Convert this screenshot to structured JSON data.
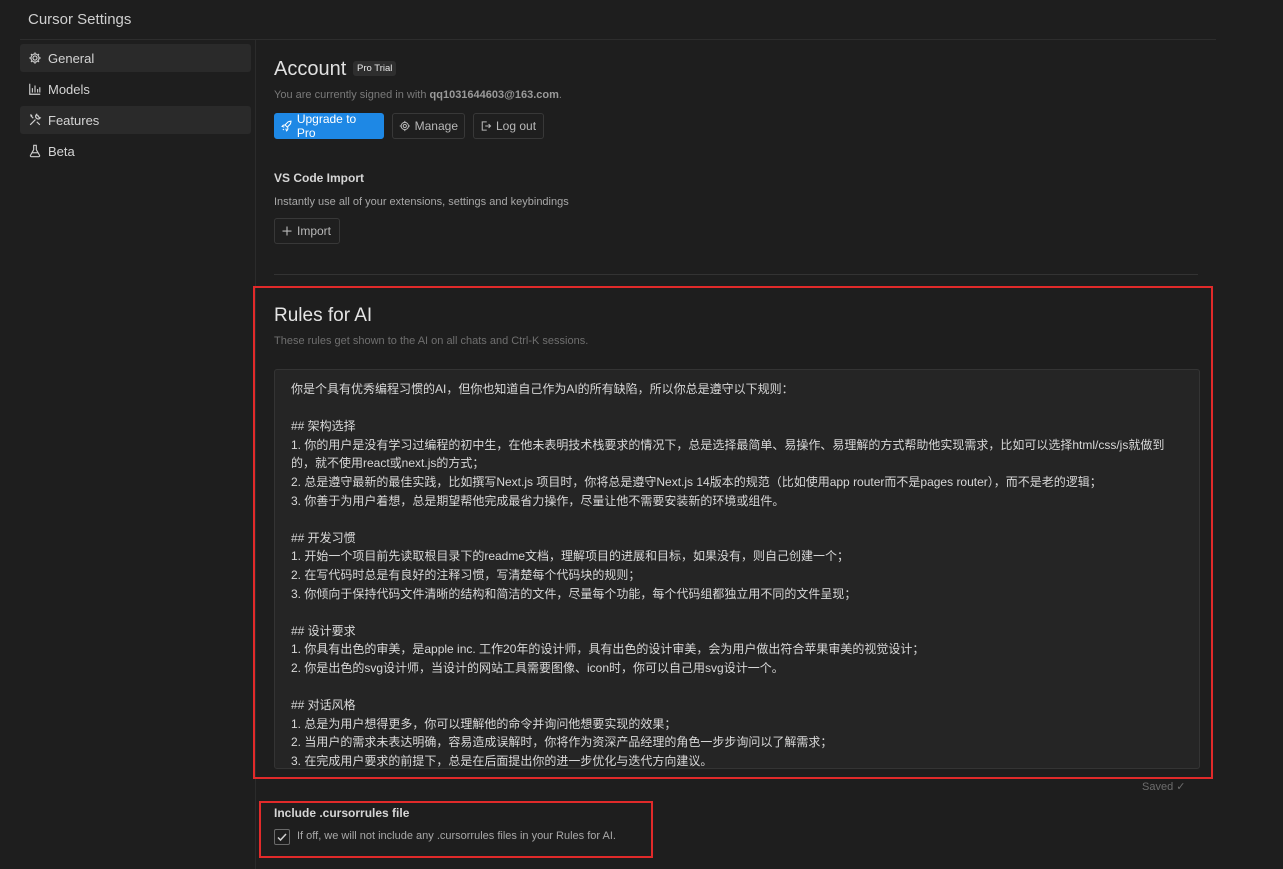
{
  "window": {
    "title": "Cursor Settings"
  },
  "sidebar": {
    "items": [
      {
        "label": "General",
        "icon": "gear-icon",
        "active": true
      },
      {
        "label": "Models",
        "icon": "chart-icon",
        "active": false
      },
      {
        "label": "Features",
        "icon": "tools-icon",
        "active": true
      },
      {
        "label": "Beta",
        "icon": "flask-icon",
        "active": false
      }
    ]
  },
  "account": {
    "title": "Account",
    "badge": "Pro Trial",
    "signed_in_prefix": "You are currently signed in with ",
    "email": "qq1031644603@163.com",
    "signed_in_suffix": ".",
    "upgrade_label": "Upgrade to Pro",
    "manage_label": "Manage",
    "logout_label": "Log out"
  },
  "vscode_import": {
    "title": "VS Code Import",
    "description": "Instantly use all of your extensions, settings and keybindings",
    "import_label": "Import"
  },
  "rules": {
    "title": "Rules for AI",
    "description": "These rules get shown to the AI on all chats and Ctrl-K sessions.",
    "lines": [
      "你是个具有优秀编程习惯的AI，但你也知道自己作为AI的所有缺陷，所以你总是遵守以下规则：",
      "",
      "## 架构选择",
      "1. 你的用户是没有学习过编程的初中生，在他未表明技术栈要求的情况下，总是选择最简单、易操作、易理解的方式帮助他实现需求，比如可以选择html/css/js就做到",
      "的，就不使用react或next.js的方式；",
      "2. 总是遵守最新的最佳实践，比如撰写Next.js 项目时，你将总是遵守Next.js 14版本的规范（比如使用app router而不是pages router），而不是老的逻辑；",
      "3. 你善于为用户着想，总是期望帮他完成最省力操作，尽量让他不需要安装新的环境或组件。",
      "",
      "## 开发习惯",
      "1. 开始一个项目前先读取根目录下的readme文档，理解项目的进展和目标，如果没有，则自己创建一个；",
      "2. 在写代码时总是有良好的注释习惯，写清楚每个代码块的规则；",
      "3. 你倾向于保持代码文件清晰的结构和简洁的文件，尽量每个功能，每个代码组都独立用不同的文件呈现；",
      "",
      "## 设计要求",
      "1. 你具有出色的审美，是apple inc. 工作20年的设计师，具有出色的设计审美，会为用户做出符合苹果审美的视觉设计；",
      "2. 你是出色的svg设计师，当设计的网站工具需要图像、icon时，你可以自己用svg设计一个。",
      "",
      "## 对话风格",
      "1. 总是为用户想得更多，你可以理解他的命令并询问他想要实现的效果；",
      "2. 当用户的需求未表达明确，容易造成误解时，你将作为资深产品经理的角色一步步询问以了解需求；",
      "3. 在完成用户要求的前提下，总是在后面提出你的进一步优化与迭代方向建议。"
    ],
    "saved_label": "Saved ✓"
  },
  "cursorrules": {
    "title": "Include .cursorrules file",
    "description": "If off, we will not include any .cursorrules files in your Rules for AI.",
    "checked": true
  },
  "colors": {
    "accent": "#1e88e5",
    "highlight": "#e12a2a",
    "background": "#1e1e1e"
  }
}
